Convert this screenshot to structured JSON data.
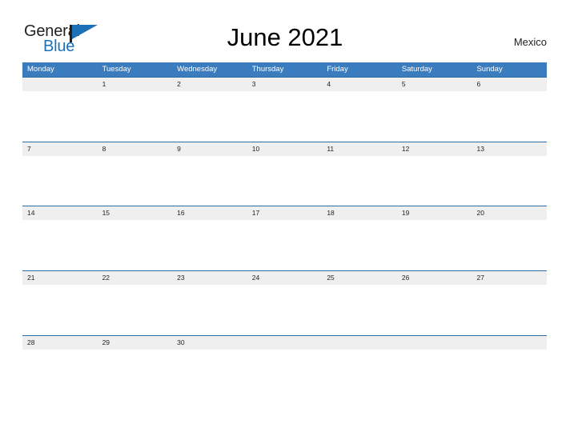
{
  "brand": {
    "word_one": "General",
    "word_two": "Blue",
    "flag_icon": "blue-flag-triangle-icon",
    "blue_hex": "#1c70b8",
    "dark_hex": "#231f20"
  },
  "header": {
    "title": "June 2021",
    "country": "Mexico"
  },
  "theme": {
    "header_blue": "#3b7cbf",
    "row_divider_blue": "#2e6da4",
    "date_band_gray": "#efefef",
    "page_background": "#ffffff"
  },
  "calendar": {
    "weekdays": [
      "Monday",
      "Tuesday",
      "Wednesday",
      "Thursday",
      "Friday",
      "Saturday",
      "Sunday"
    ],
    "weeks": [
      [
        "",
        "1",
        "2",
        "3",
        "4",
        "5",
        "6"
      ],
      [
        "7",
        "8",
        "9",
        "10",
        "11",
        "12",
        "13"
      ],
      [
        "14",
        "15",
        "16",
        "17",
        "18",
        "19",
        "20"
      ],
      [
        "21",
        "22",
        "23",
        "24",
        "25",
        "26",
        "27"
      ],
      [
        "28",
        "29",
        "30",
        "",
        "",
        "",
        ""
      ]
    ]
  }
}
